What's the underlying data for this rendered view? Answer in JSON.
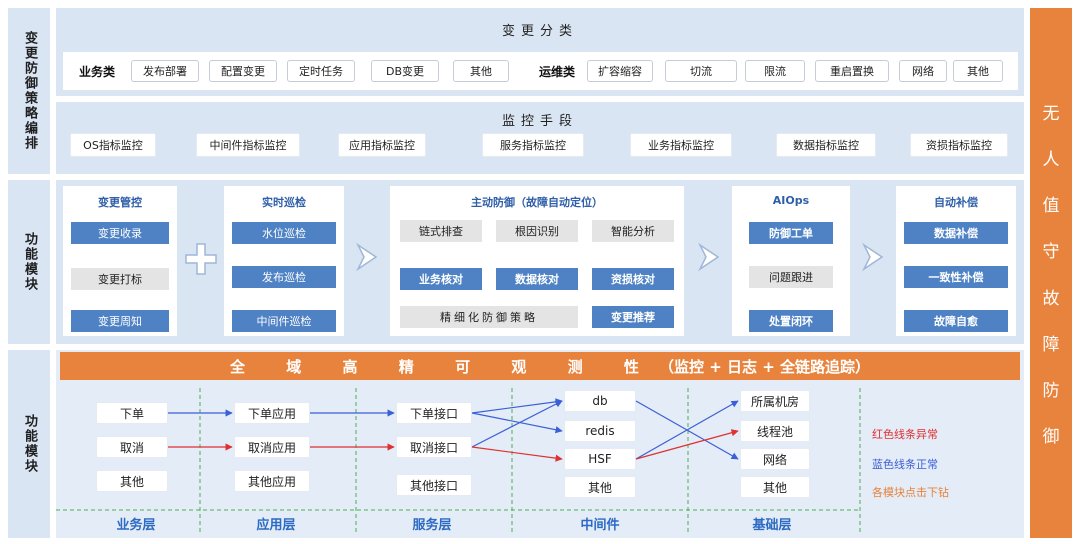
{
  "side": {
    "top": "变更防御策略编排",
    "mid": "功能模块",
    "bottom": "功能模块"
  },
  "change_class": {
    "title": "变更分类",
    "business_label": "业务类",
    "business": [
      "发布部署",
      "配置变更",
      "定时任务",
      "DB变更",
      "其他"
    ],
    "ops_label": "运维类",
    "ops": [
      "扩容缩容",
      "切流",
      "限流",
      "重启置换",
      "网络",
      "其他"
    ]
  },
  "monitor": {
    "title": "监控手段",
    "items": [
      "OS指标监控",
      "中间件指标监控",
      "应用指标监控",
      "服务指标监控",
      "业务指标监控",
      "数据指标监控",
      "资损指标监控"
    ]
  },
  "modules": {
    "change_ctrl": {
      "title": "变更管控",
      "items": [
        "变更收录",
        "变更打标",
        "变更周知"
      ]
    },
    "patrol": {
      "title": "实时巡检",
      "items": [
        "水位巡检",
        "发布巡检",
        "中间件巡检"
      ]
    },
    "active": {
      "title": "主动防御（故障自动定位）",
      "row1": [
        "链式排查",
        "根因识别",
        "智能分析"
      ],
      "row2": [
        "业务核对",
        "数据核对",
        "资损核对"
      ],
      "strategy": "精细化防御策略",
      "recommend": "变更推荐"
    },
    "aiops": {
      "title": "AIOps",
      "items": [
        "防御工单",
        "问题跟进",
        "处置闭环"
      ]
    },
    "compensate": {
      "title": "自动补偿",
      "items": [
        "数据补偿",
        "一致性补偿",
        "故障自愈"
      ]
    }
  },
  "observe": {
    "chars": [
      "全",
      "域",
      "高",
      "精",
      "可",
      "观",
      "测",
      "性"
    ],
    "paren": "（监控 + 日志 + 全链路追踪）"
  },
  "layers": {
    "business": {
      "label": "业务层",
      "items": [
        "下单",
        "取消",
        "其他"
      ]
    },
    "app": {
      "label": "应用层",
      "items": [
        "下单应用",
        "取消应用",
        "其他应用"
      ]
    },
    "service": {
      "label": "服务层",
      "items": [
        "下单接口",
        "取消接口",
        "其他接口"
      ]
    },
    "middleware": {
      "label": "中间件",
      "items": [
        "db",
        "redis",
        "HSF",
        "其他"
      ]
    },
    "base": {
      "label": "基础层",
      "items": [
        "所属机房",
        "线程池",
        "网络",
        "其他"
      ]
    }
  },
  "legend": {
    "red": "红色线条异常",
    "blue": "蓝色线条正常",
    "drill": "各模块点击下钻"
  },
  "right": [
    "无",
    "人",
    "值",
    "守",
    "故",
    "障",
    "防",
    "御"
  ],
  "colors": {
    "blue": "#4f82c4",
    "orange": "#e8833d",
    "band": "#dae5f3",
    "red": "#e03030",
    "lineblue": "#3b5fd6"
  }
}
